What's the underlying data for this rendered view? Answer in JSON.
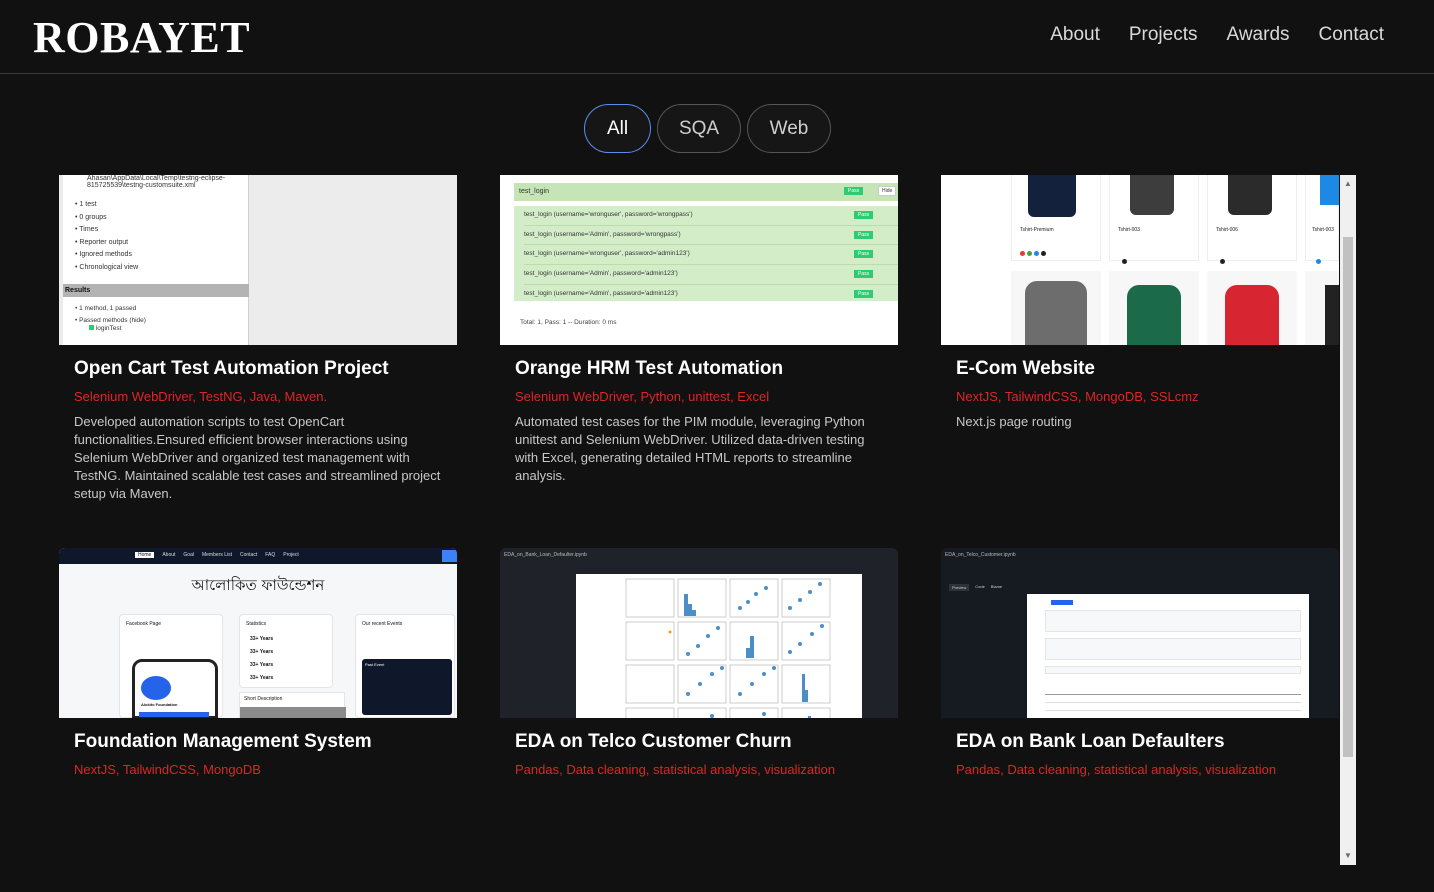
{
  "header": {
    "logo": "ROBAYET",
    "nav": [
      "About",
      "Projects",
      "Awards",
      "Contact"
    ]
  },
  "filters": [
    "All",
    "SQA",
    "Web"
  ],
  "active_filter": "All",
  "projects": [
    {
      "title": "Open Cart Test Automation Project",
      "tech": "Selenium WebDriver, TestNG, Java, Maven.",
      "desc": "Developed automation scripts to test OpenCart functionalities.Ensured efficient browser interactions using Selenium WebDriver and organized test management with TestNG. Maintained scalable test cases and streamlined project setup via Maven.",
      "shot": {
        "lines": [
          "Ahasan\\AppData\\Local\\Temp\\testng-eclipse-",
          "815725539\\testng-customsuite.xml",
          "1 test",
          "0 groups",
          "Times",
          "Reporter output",
          "Ignored methods",
          "Chronological view"
        ],
        "results_label": "Results",
        "result_lines": [
          "1 method, 1 passed",
          "Passed methods (hide)",
          "loginTest"
        ]
      }
    },
    {
      "title": "Orange HRM Test Automation",
      "tech": "Selenium WebDriver, Python, unittest, Excel",
      "desc": "Automated test cases for the PIM module, leveraging Python unittest and Selenium WebDriver. Utilized data-driven testing with Excel, generating detailed HTML reports to streamline analysis.",
      "shot": {
        "group": "test_login",
        "hide": "Hide",
        "pass": "Pass",
        "rows": [
          "test_login (username='wronguser', password='wrongpass')",
          "test_login (username='Admin', password='wrongpass')",
          "test_login (username='wronguser', password='admin123')",
          "test_login (username='Admin', password='admin123')",
          "test_login (username='Admin', password='admin123')"
        ],
        "total": "Total: 1, Pass: 1 -- Duration: 0 ms"
      }
    },
    {
      "title": "E-Com Website",
      "tech": "NextJS, TailwindCSS, MongoDB, SSLcmz",
      "desc": "Next.js page routing",
      "shot": {
        "items": [
          "Tshirt-Premium",
          "Tshirt-003",
          "Tshirt-006",
          "Tshirt-003"
        ]
      }
    },
    {
      "title": "Foundation Management System",
      "tech": "NextJS, TailwindCSS, MongoDB",
      "desc": "",
      "shot": {
        "nav": [
          "Home",
          "About",
          "Goal",
          "Members List",
          "Contact",
          "FAQ",
          "Project"
        ],
        "heading": "আলোকিত ফাউন্ডেশন",
        "panels": [
          "Facebook Page",
          "Statistics",
          "Our recent Events"
        ],
        "stats": [
          "33+ Years",
          "33+ Years",
          "33+ Years",
          "33+ Years"
        ],
        "events": [
          "Past Event"
        ],
        "short_desc": "Short Description",
        "profile": "Alokito Foundation"
      }
    },
    {
      "title": "EDA on Telco Customer Churn",
      "tech": "Pandas, Data cleaning, statistical analysis, visualization",
      "desc": "",
      "shot": {
        "path": "EDA_on_Bank_Loan_Defaulter.ipynb"
      }
    },
    {
      "title": "EDA on Bank Loan Defaulters",
      "tech": "Pandas, Data cleaning, statistical analysis, visualization",
      "desc": "",
      "shot": {
        "path": "EDA_on_Telco_Customer.ipynb",
        "tabs": [
          "Preview",
          "Code",
          "Blame"
        ]
      }
    }
  ],
  "colors": {
    "background": "#111111",
    "accent_red": "#dc2626",
    "active_border": "#5b8def",
    "pass_green": "#2ecc71",
    "report_green_bg": "#d4edc9"
  }
}
